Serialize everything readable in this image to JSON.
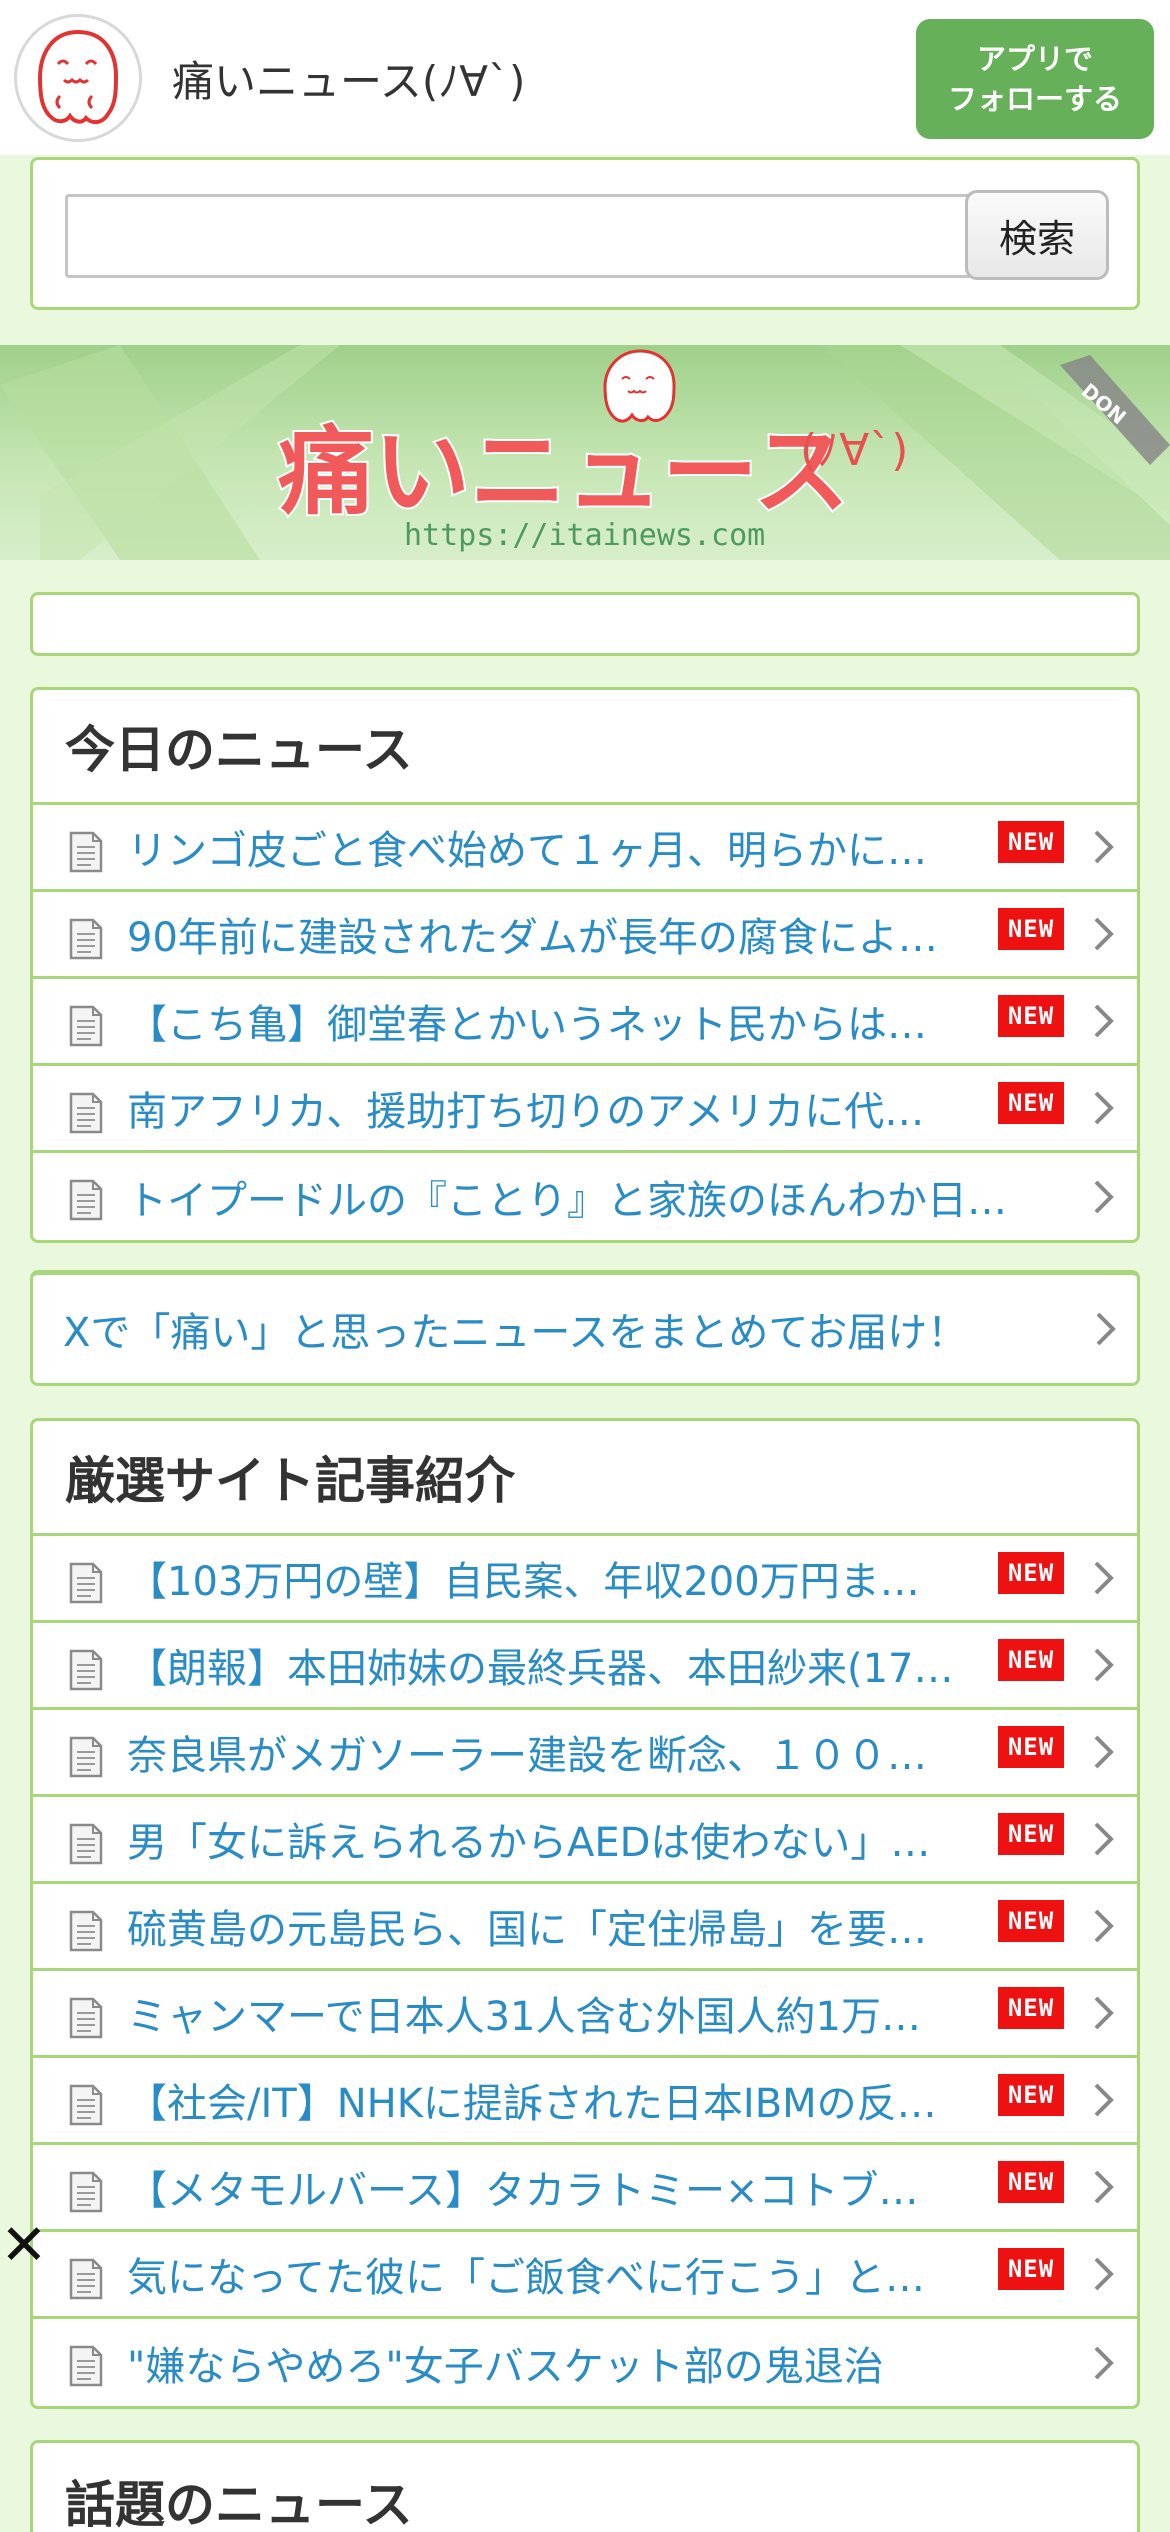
{
  "header": {
    "title": "痛いニュース(ﾉ∀`)",
    "follow_line1": "アプリで",
    "follow_line2": "フォローする"
  },
  "search": {
    "value": "",
    "button_label": "検索"
  },
  "banner": {
    "logo_text": "痛いニュース",
    "logo_suffix": "(ﾉ∀`)",
    "url": "https://itainews.com"
  },
  "today_news": {
    "title": "今日のニュース",
    "items": [
      {
        "text": "リンゴ皮ごと食べ始めて１ヶ月、明らかに…",
        "new": true
      },
      {
        "text": "90年前に建設されたダムが長年の腐食によ…",
        "new": true
      },
      {
        "text": "【こち亀】御堂春とかいうネット民からは…",
        "new": true
      },
      {
        "text": "南アフリカ、援助打ち切りのアメリカに代…",
        "new": true
      },
      {
        "text": "トイプードルの『ことり』と家族のほんわか日…",
        "new": false
      }
    ]
  },
  "x_link": {
    "text": "Xで「痛い」と思ったニュースをまとめてお届け！"
  },
  "featured": {
    "title": "厳選サイト記事紹介",
    "items": [
      {
        "text": "【103万円の壁】自民案、年収200万円ま…",
        "new": true
      },
      {
        "text": "【朗報】本田姉妹の最終兵器、本田紗来(17…",
        "new": true
      },
      {
        "text": "奈良県がメガソーラー建設を断念、１００…",
        "new": true
      },
      {
        "text": "男「女に訴えられるからAEDは使わない」…",
        "new": true
      },
      {
        "text": "硫黄島の元島民ら、国に「定住帰島」を要…",
        "new": true
      },
      {
        "text": "ミャンマーで日本人31人含む外国人約1万…",
        "new": true
      },
      {
        "text": "【社会/IT】NHKに提訴された日本IBMの反…",
        "new": true
      },
      {
        "text": "【メタモルバース】タカラトミー×コトブ…",
        "new": true
      },
      {
        "text": "気になってた彼に「ご飯食べに行こう」と…",
        "new": true
      },
      {
        "text": "\"嫌ならやめろ\"女子バスケット部の鬼退治",
        "new": false
      }
    ]
  },
  "trending": {
    "title": "話題のニュース"
  },
  "badge_label": "NEW",
  "close_label": "✕"
}
